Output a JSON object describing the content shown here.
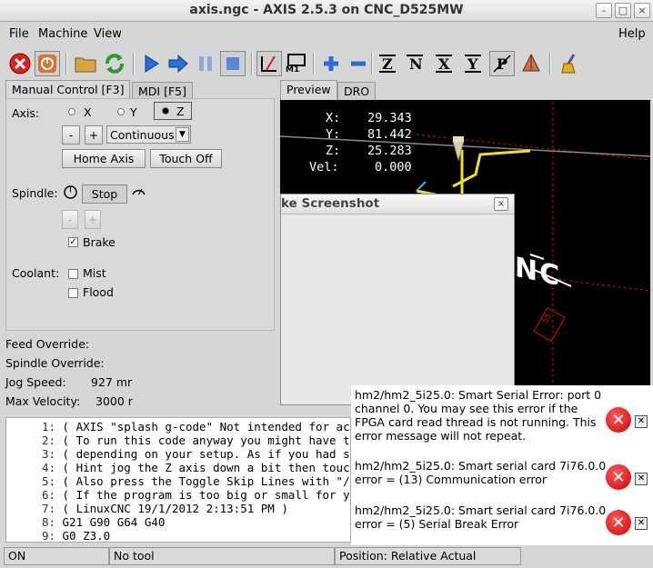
{
  "window": {
    "title": "axis.ngc - AXIS 2.5.3 on CNC_D525MW"
  },
  "menu": {
    "file": "File",
    "machine": "Machine",
    "view": "View",
    "help": "Help"
  },
  "toolbar": {
    "m1_label": "M1"
  },
  "tabs": {
    "manual": "Manual Control [F3]",
    "mdi": "MDI [F5]",
    "preview": "Preview",
    "dro": "DRO"
  },
  "manual": {
    "axis_label": "Axis:",
    "axis_x": "X",
    "axis_y": "Y",
    "axis_z": "Z",
    "minus": "-",
    "plus": "+",
    "jog_mode": "Continuous",
    "home_axis": "Home Axis",
    "touch_off": "Touch Off",
    "spindle_label": "Spindle:",
    "stop": "Stop",
    "spindle_minus": "-",
    "spindle_plus": "+",
    "brake": "Brake",
    "coolant_label": "Coolant:",
    "mist": "Mist",
    "flood": "Flood"
  },
  "overrides": {
    "feed_override": "Feed Override:",
    "spindle_override": "Spindle Override:",
    "jog_speed_label": "Jog Speed:",
    "jog_speed_value": "927 mr",
    "max_velocity_label": "Max Velocity:",
    "max_velocity_value": "3000 r"
  },
  "dro": {
    "x_label": "X:",
    "x_value": "29.343",
    "y_label": "Y:",
    "y_value": "81.442",
    "z_label": "Z:",
    "z_value": "25.283",
    "vel_label": "Vel:",
    "vel_value": "0.000"
  },
  "preview_text": {
    "cnc": "NC",
    "num": "55"
  },
  "dialog": {
    "title": "ke Screenshot",
    "close": "×"
  },
  "gcode": [
    {
      "n": "1:",
      "text": "( AXIS \"splash g-code\" Not intended for actual"
    },
    {
      "n": "2:",
      "text": "( To run this code anyway you might have to To"
    },
    {
      "n": "3:",
      "text": "( depending on your setup. As if you had some"
    },
    {
      "n": "4:",
      "text": "( Hint jog the Z axis down a bit then touch of"
    },
    {
      "n": "5:",
      "text": "( Also press the Toggle Skip Lines with \"/\" to"
    },
    {
      "n": "6:",
      "text": "( If the program is too big or small for your"
    },
    {
      "n": "7:",
      "text": "( LinuxCNC 19/1/2012 2:13:51 PM )"
    },
    {
      "n": "8:",
      "text": "G21 G90 G64 G40"
    },
    {
      "n": "9:",
      "text": "G0 Z3.0"
    }
  ],
  "errors": [
    {
      "text": "hm2/hm2_5i25.0: Smart Serial Error: port 0 channel 0. You may see this error if the FPGA card read thread is not running. This error message will not repeat."
    },
    {
      "text": "hm2/hm2_5i25.0: Smart serial card 7i76.0.0 error = (13) Communication error"
    },
    {
      "text": "hm2/hm2_5i25.0: Smart serial card 7i76.0.0 error = (5) Serial Break Error"
    }
  ],
  "status": {
    "state": "ON",
    "tool": "No tool",
    "position": "Position: Relative Actual"
  },
  "colors": {
    "estop_red": "#e02020",
    "toolpath_yellow": "#f0e020",
    "limits_red": "#d01010",
    "error_red": "#d00000",
    "preview_bg": "#000000"
  }
}
